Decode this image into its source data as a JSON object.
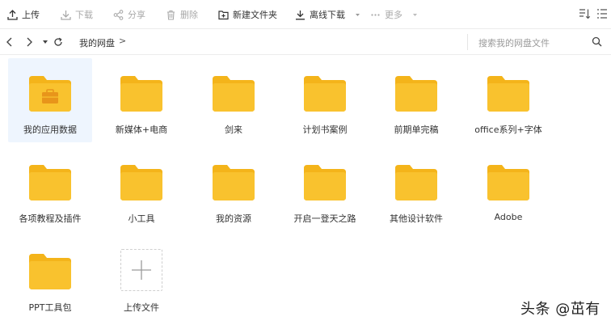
{
  "toolbar": {
    "upload": "上传",
    "download": "下载",
    "share": "分享",
    "delete": "删除",
    "new_folder": "新建文件夹",
    "offline_download": "离线下载",
    "more": "更多"
  },
  "navbar": {
    "breadcrumb_root": "我的网盘",
    "breadcrumb_sep": ">",
    "search_placeholder": "搜索我的网盘文件"
  },
  "items": [
    {
      "label": "我的应用数据",
      "type": "app-folder",
      "selected": true
    },
    {
      "label": "新媒体+电商",
      "type": "folder"
    },
    {
      "label": "剑来",
      "type": "folder"
    },
    {
      "label": "计划书案例",
      "type": "folder"
    },
    {
      "label": "前期单完稿",
      "type": "folder"
    },
    {
      "label": "office系列+字体",
      "type": "folder"
    },
    {
      "label": "各项教程及插件",
      "type": "folder"
    },
    {
      "label": "小工具",
      "type": "folder"
    },
    {
      "label": "我的资源",
      "type": "folder"
    },
    {
      "label": "开启一登天之路",
      "type": "folder"
    },
    {
      "label": "其他设计软件",
      "type": "folder"
    },
    {
      "label": "Adobe",
      "type": "folder"
    },
    {
      "label": "PPT工具包",
      "type": "folder"
    },
    {
      "label": "上传文件",
      "type": "upload"
    }
  ],
  "watermark": "头条 @茁有",
  "colors": {
    "folder": "#f9c22e",
    "folder_tab": "#f4b41a",
    "selected_bg": "#eef5fe"
  }
}
